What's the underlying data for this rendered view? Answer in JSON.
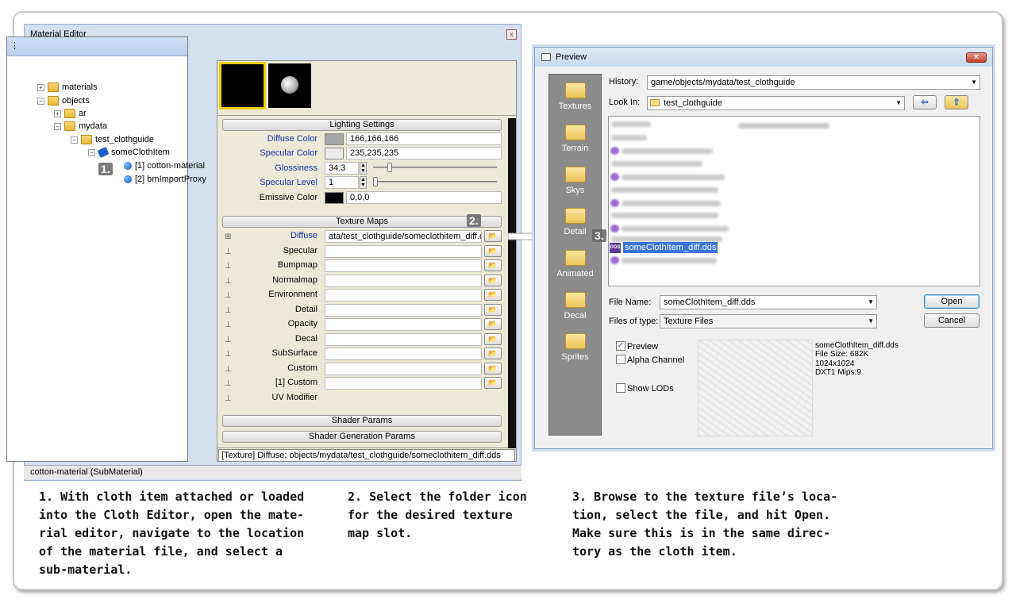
{
  "material_editor": {
    "title": "Material Editor",
    "close_glyph": "x",
    "toolbar_glyphs": "⁝⚲⚒",
    "tree_header": "⋮",
    "tree": [
      {
        "label": "materials",
        "pm": "+"
      },
      {
        "label": "objects",
        "pm": "−"
      },
      {
        "label": "ar",
        "pm": "+"
      },
      {
        "label": "mydata",
        "pm": "−"
      },
      {
        "label": "test_clothguide",
        "pm": "−"
      },
      {
        "label": "someClothItem",
        "pm": "−"
      },
      {
        "label": "[1] cotton-material"
      },
      {
        "label": "[2] bmImportProxy"
      }
    ],
    "step1_marker": "1.",
    "lighting_header": "Lighting Settings",
    "lighting": [
      {
        "label": "Diffuse Color",
        "value": "166,166,166",
        "swatch": "#a6a6a6"
      },
      {
        "label": "Specular Color",
        "value": "235,235,235",
        "swatch": "#ebebeb"
      },
      {
        "label": "Glossiness",
        "value": "34.3"
      },
      {
        "label": "Specular Level",
        "value": "1"
      },
      {
        "label": "Emissive Color",
        "value": "0,0,0",
        "swatch": "#000000"
      }
    ],
    "texture_header": "Texture Maps",
    "step2_marker": "2.",
    "textures": [
      {
        "label": "Diffuse",
        "value": "ata/test_clothguide/someclothitem_diff.dds"
      },
      {
        "label": "Specular",
        "value": ""
      },
      {
        "label": "Bumpmap",
        "value": ""
      },
      {
        "label": "Normalmap",
        "value": ""
      },
      {
        "label": "Environment",
        "value": ""
      },
      {
        "label": "Detail",
        "value": ""
      },
      {
        "label": "Opacity",
        "value": ""
      },
      {
        "label": "Decal",
        "value": ""
      },
      {
        "label": "SubSurface",
        "value": ""
      },
      {
        "label": "Custom",
        "value": ""
      },
      {
        "label": "[1] Custom",
        "value": ""
      },
      {
        "label": "UV Modifier"
      }
    ],
    "shader_params": "Shader Params",
    "shader_gen_params": "Shader Generation Params",
    "texture_status": "[Texture] Diffuse: objects/mydata/test_clothguide/someclothitem_diff.dds",
    "status": "cotton-material (SubMaterial)"
  },
  "preview": {
    "title": "Preview",
    "close_glyph": "✕",
    "places": [
      "Textures",
      "Terrain",
      "Skys",
      "Detail",
      "Animated",
      "Decal",
      "Sprites"
    ],
    "history_label": "History:",
    "history_value": "game/objects/mydata/test_clothguide",
    "lookin_label": "Look In:",
    "lookin_value": "test_clothguide",
    "back_glyph": "⇦",
    "up_glyph": "⇧",
    "step3_marker": "3.",
    "selected_file": "someClothItem_diff.dds",
    "dds_badge": "DDS",
    "filename_label": "File Name:",
    "filename_value": "someClothItem_diff.dds",
    "filetype_label": "Files of type:",
    "filetype_value": "Texture Files",
    "open_label": "Open",
    "cancel_label": "Cancel",
    "preview_cb": "Preview",
    "alpha_cb": "Alpha Channel",
    "lods_cb": "Show LODs",
    "info": [
      "someClothItem_diff.dds",
      "File Size: 682K",
      "1024x1024",
      "DXT1 Mips:9"
    ]
  },
  "captions": {
    "c1": "1. With cloth item attached or loaded\ninto the Cloth Editor, open the mate-\nrial editor, navigate to the location\nof the material file, and select a\nsub-material.",
    "c2": "2. Select the folder icon\nfor the desired texture\nmap slot.",
    "c3": "3. Browse to the texture file’s loca-\ntion, select the file, and hit Open.\nMake sure this is in the same direc-\ntory as the cloth item."
  }
}
